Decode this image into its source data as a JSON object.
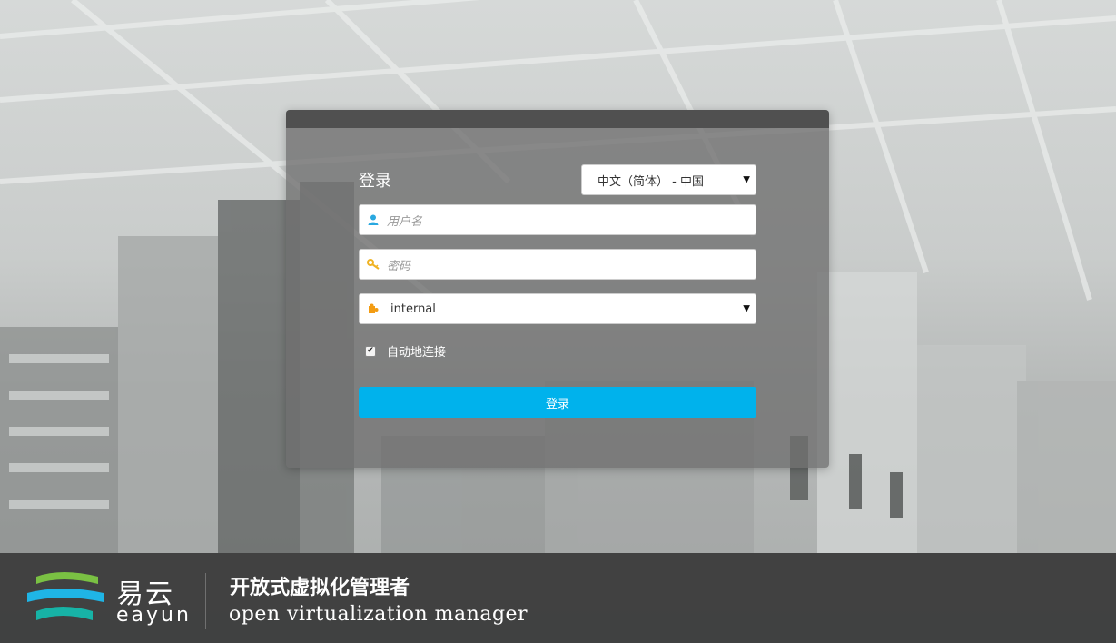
{
  "login_form": {
    "title": "登录",
    "language_select": {
      "selected": "中文（简体） - 中国"
    },
    "username": {
      "placeholder": "用户名",
      "value": ""
    },
    "password": {
      "placeholder": "密码",
      "value": ""
    },
    "domain_select": {
      "selected": "internal"
    },
    "auto_connect": {
      "label": "自动地连接",
      "checked": true
    },
    "submit_label": "登录"
  },
  "footer": {
    "brand_cn": "易云",
    "brand_en": "eayun",
    "tagline_cn": "开放式虚拟化管理者",
    "tagline_en": "open virtualization manager"
  },
  "icons": {
    "username": "user-icon",
    "password": "key-icon",
    "domain": "puzzle-icon",
    "checkbox": "check-icon",
    "dropdown": "caret-down-icon"
  },
  "colors": {
    "accent_button": "#00b2ec",
    "user_icon": "#29a8e0",
    "key_icon": "#f0b323",
    "puzzle_icon": "#f39c12",
    "logo_green": "#7ac143",
    "logo_blue": "#1fb5e6",
    "logo_teal": "#17b3a6"
  }
}
